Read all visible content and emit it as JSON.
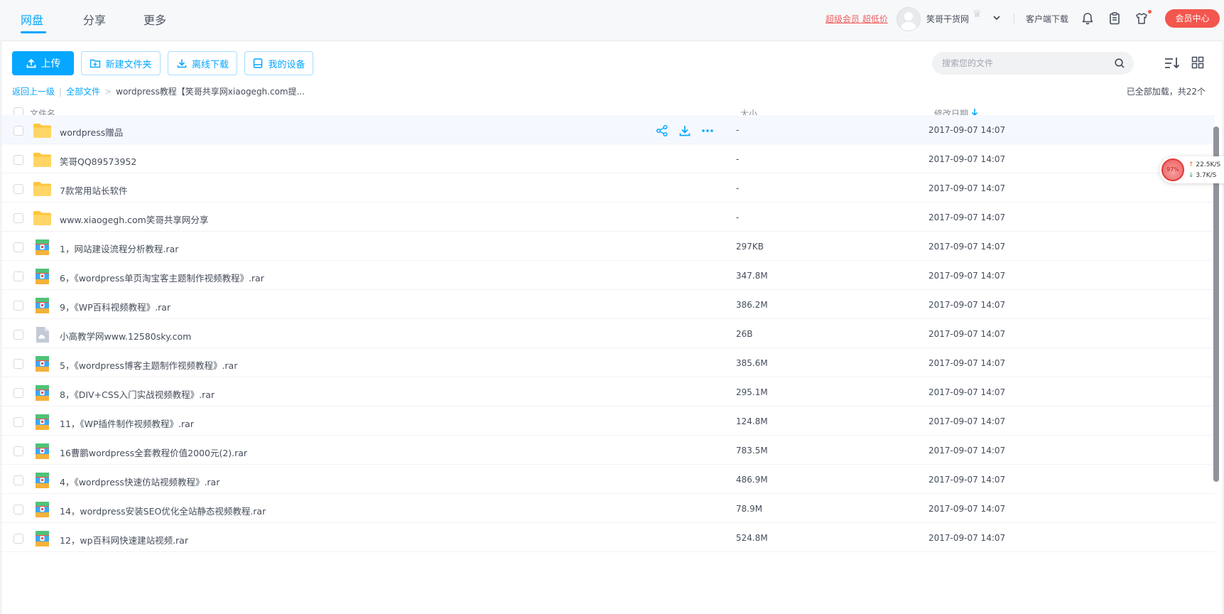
{
  "nav": {
    "tabs": [
      {
        "label": "网盘"
      },
      {
        "label": "分享"
      },
      {
        "label": "更多"
      }
    ]
  },
  "header": {
    "promo": "超级会员 超低价",
    "username": "笑哥干货网",
    "client_download": "客户端下载",
    "vip_center": "会员中心"
  },
  "toolbar": {
    "upload": "上传",
    "new_folder": "新建文件夹",
    "offline_download": "离线下载",
    "my_devices": "我的设备",
    "search_placeholder": "搜索您的文件"
  },
  "breadcrumb": {
    "back": "返回上一级",
    "separator_1": "|",
    "all_files": "全部文件",
    "separator_2": ">",
    "current": "wordpress教程【笑哥共享网xiaogegh.com提..."
  },
  "status": {
    "loaded": "已全部加载，共22个"
  },
  "columns": {
    "name": "文件名",
    "size": "大小",
    "date": "修改日期"
  },
  "files": [
    {
      "name": "wordpress赠品",
      "size": "-",
      "date": "2017-09-07 14:07",
      "type": "folder"
    },
    {
      "name": "笑哥QQ89573952",
      "size": "-",
      "date": "2017-09-07 14:07",
      "type": "folder"
    },
    {
      "name": "7款常用站长软件",
      "size": "-",
      "date": "2017-09-07 14:07",
      "type": "folder"
    },
    {
      "name": "www.xiaogegh.com笑哥共享网分享",
      "size": "-",
      "date": "2017-09-07 14:07",
      "type": "folder"
    },
    {
      "name": "1，网站建设流程分析教程.rar",
      "size": "297KB",
      "date": "2017-09-07 14:07",
      "type": "archive"
    },
    {
      "name": "6，《wordpress单页淘宝客主题制作视频教程》.rar",
      "size": "347.8M",
      "date": "2017-09-07 14:07",
      "type": "archive"
    },
    {
      "name": "9，《WP百科视频教程》.rar",
      "size": "386.2M",
      "date": "2017-09-07 14:07",
      "type": "archive"
    },
    {
      "name": "小高教学网www.12580sky.com",
      "size": "26B",
      "date": "2017-09-07 14:07",
      "type": "link"
    },
    {
      "name": "5，《wordpress博客主题制作视频教程》.rar",
      "size": "385.6M",
      "date": "2017-09-07 14:07",
      "type": "archive"
    },
    {
      "name": "8，《DIV+CSS入门实战视频教程》.rar",
      "size": "295.1M",
      "date": "2017-09-07 14:07",
      "type": "archive"
    },
    {
      "name": "11，《WP插件制作视频教程》.rar",
      "size": "124.8M",
      "date": "2017-09-07 14:07",
      "type": "archive"
    },
    {
      "name": "16曹鹏wordpress全套教程价值2000元(2).rar",
      "size": "783.5M",
      "date": "2017-09-07 14:07",
      "type": "archive"
    },
    {
      "name": "4，《wordpress快速仿站视频教程》.rar",
      "size": "486.9M",
      "date": "2017-09-07 14:07",
      "type": "archive"
    },
    {
      "name": "14，wordpress安装SEO优化全站静态视频教程.rar",
      "size": "78.9M",
      "date": "2017-09-07 14:07",
      "type": "archive"
    },
    {
      "name": "12，wp百科网快速建站视频.rar",
      "size": "524.8M",
      "date": "2017-09-07 14:07",
      "type": "archive"
    }
  ],
  "speed_widget": {
    "percent": "97%",
    "upload": "22.5K/S",
    "download": "3.7K/S"
  },
  "colors": {
    "accent": "#06a7ff",
    "vip": "#f3564e",
    "folder": "#ffcb3d"
  }
}
